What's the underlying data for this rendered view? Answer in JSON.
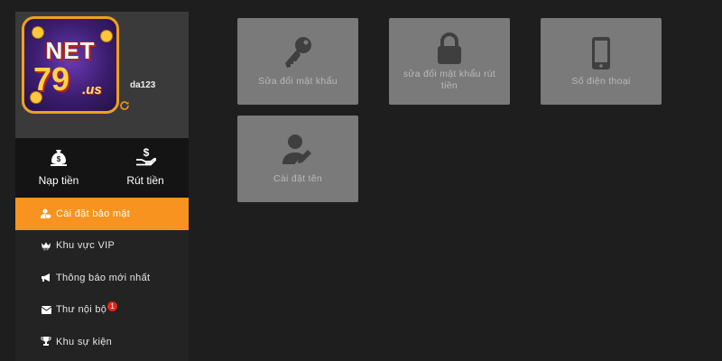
{
  "profile": {
    "logo_text_net": "NET",
    "logo_text_num": "79",
    "logo_text_us": ".us",
    "username": "da123"
  },
  "wallet": {
    "deposit_label": "Nạp tiền",
    "withdraw_label": "Rút tiền"
  },
  "menu": {
    "items": [
      {
        "label": "Cài đặt bảo mật",
        "icon": "user-shield-icon",
        "active": true
      },
      {
        "label": "Khu vực VIP",
        "icon": "vip-crown-icon",
        "active": false
      },
      {
        "label": "Thông báo mới nhất",
        "icon": "megaphone-icon",
        "active": false
      },
      {
        "label": "Thư nội bộ",
        "icon": "envelope-icon",
        "active": false,
        "badge": "1"
      },
      {
        "label": "Khu sự kiện",
        "icon": "trophy-icon",
        "active": false
      }
    ]
  },
  "cards": [
    {
      "label": "Sửa đổi mật khẩu",
      "icon": "key-icon"
    },
    {
      "label": "sửa đổi mật khẩu rút tiền",
      "icon": "lock-icon"
    },
    {
      "label": "Số điện thoại",
      "icon": "mobile-phone-icon"
    },
    {
      "label": "Cài đặt tên",
      "icon": "user-edit-icon"
    }
  ],
  "colors": {
    "accent": "#f7931e",
    "background": "#1e1e1e",
    "sidebar": "#232323",
    "card": "#7a7a7a",
    "badge": "#e0261b"
  }
}
